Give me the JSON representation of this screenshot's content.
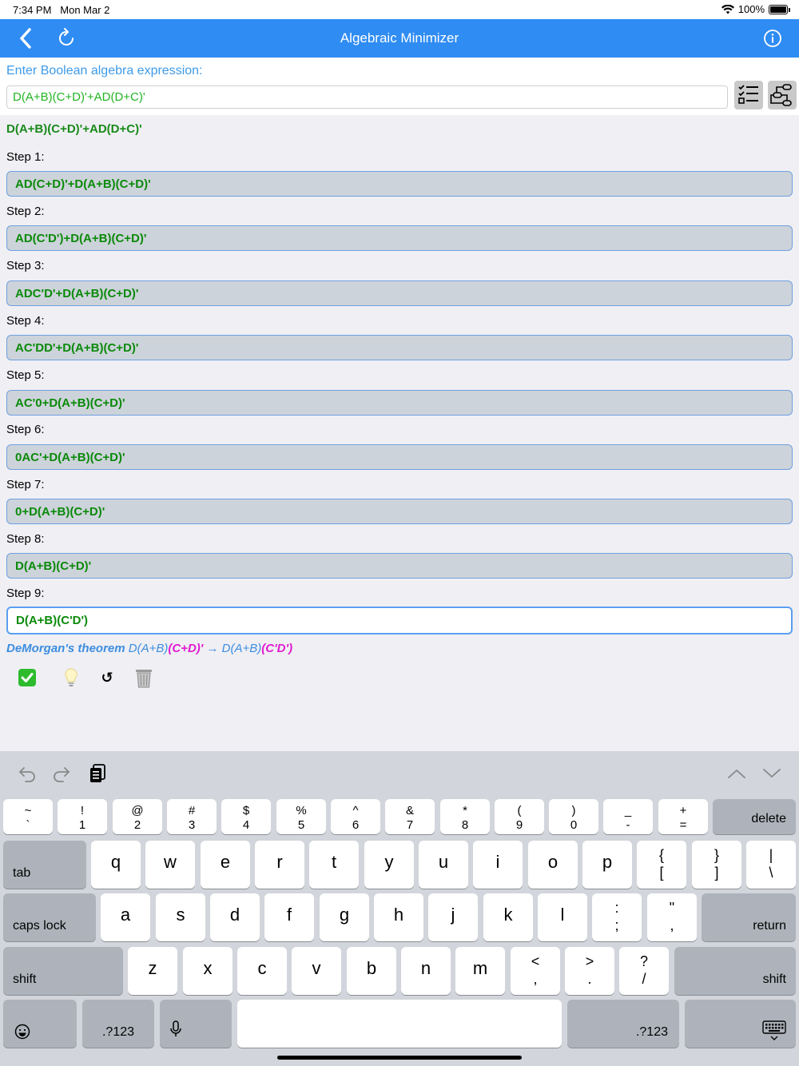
{
  "status": {
    "time": "7:34 PM",
    "date": "Mon Mar 2",
    "battery": "100%"
  },
  "nav": {
    "title": "Algebraic Minimizer",
    "back_icon": "chevron-left-icon",
    "refresh_icon": "refresh-icon",
    "info_icon": "info-icon"
  },
  "input": {
    "prompt": "Enter Boolean algebra expression:",
    "value": "D(A+B)(C+D)'+AD(D+C)'"
  },
  "expression": "D(A+B)(C+D)'+AD(D+C)'",
  "steps": [
    {
      "label": "Step 1:",
      "value": "AD(C+D)'+D(A+B)(C+D)'"
    },
    {
      "label": "Step 2:",
      "value": "AD(C'D')+D(A+B)(C+D)'"
    },
    {
      "label": "Step 3:",
      "value": "ADC'D'+D(A+B)(C+D)'"
    },
    {
      "label": "Step 4:",
      "value": "AC'DD'+D(A+B)(C+D)'"
    },
    {
      "label": "Step 5:",
      "value": "AC'0+D(A+B)(C+D)'"
    },
    {
      "label": "Step 6:",
      "value": "0AC'+D(A+B)(C+D)'"
    },
    {
      "label": "Step 7:",
      "value": "0+D(A+B)(C+D)'"
    },
    {
      "label": "Step 8:",
      "value": "D(A+B)(C+D)'"
    },
    {
      "label": "Step 9:",
      "value": "D(A+B)(C'D')"
    }
  ],
  "rule": {
    "name": "DeMorgan's theorem",
    "before_prefix": " D(A+B)",
    "before_hl": "(C+D)'",
    "arrow": " → D(A+B)",
    "after_hl": "(C'D')"
  },
  "actions": {
    "check": "✅",
    "hint": "💡",
    "undo": "↺",
    "trash": "🗑"
  },
  "keyboard": {
    "row1": [
      {
        "t": "~",
        "b": "`"
      },
      {
        "t": "!",
        "b": "1"
      },
      {
        "t": "@",
        "b": "2"
      },
      {
        "t": "#",
        "b": "3"
      },
      {
        "t": "$",
        "b": "4"
      },
      {
        "t": "%",
        "b": "5"
      },
      {
        "t": "^",
        "b": "6"
      },
      {
        "t": "&",
        "b": "7"
      },
      {
        "t": "*",
        "b": "8"
      },
      {
        "t": "(",
        "b": "9"
      },
      {
        "t": ")",
        "b": "0"
      },
      {
        "t": "_",
        "b": "-"
      },
      {
        "t": "+",
        "b": "="
      }
    ],
    "delete": "delete",
    "tab": "tab",
    "row2": [
      "q",
      "w",
      "e",
      "r",
      "t",
      "y",
      "u",
      "i",
      "o",
      "p"
    ],
    "row2_syms": [
      {
        "t": "{",
        "b": "["
      },
      {
        "t": "}",
        "b": "]"
      },
      {
        "t": "|",
        "b": "\\"
      }
    ],
    "caps": "caps lock",
    "row3": [
      "a",
      "s",
      "d",
      "f",
      "g",
      "h",
      "j",
      "k",
      "l"
    ],
    "row3_syms": [
      {
        "t": ":",
        "b": ";"
      },
      {
        "t": "\"",
        "b": ","
      }
    ],
    "return": "return",
    "shift": "shift",
    "row4": [
      "z",
      "x",
      "c",
      "v",
      "b",
      "n",
      "m"
    ],
    "row4_syms": [
      {
        "t": "<",
        "b": ","
      },
      {
        "t": ">",
        "b": "."
      },
      {
        "t": "?",
        "b": "/"
      }
    ],
    "emoji": "☺",
    "num": ".?123",
    "mic": "mic-icon"
  }
}
